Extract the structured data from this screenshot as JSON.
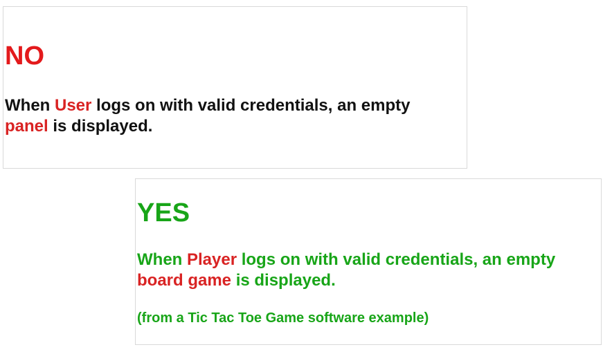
{
  "colors": {
    "no": "#e31a1c",
    "yes": "#18a518",
    "highlight": "#d92323",
    "text": "#111111"
  },
  "no_card": {
    "heading": "NO",
    "line1": {
      "before": "When ",
      "term": "User",
      "after": " logs on with valid credentials, an empty"
    },
    "line2": {
      "term": "panel",
      "after": " is displayed."
    }
  },
  "yes_card": {
    "heading": "YES",
    "line1": {
      "before": "When ",
      "term": "Player",
      "after": " logs on with valid credentials, an empty"
    },
    "line2": {
      "term": "board game",
      "after": " is displayed."
    },
    "note": "(from a Tic Tac Toe Game software example)"
  }
}
